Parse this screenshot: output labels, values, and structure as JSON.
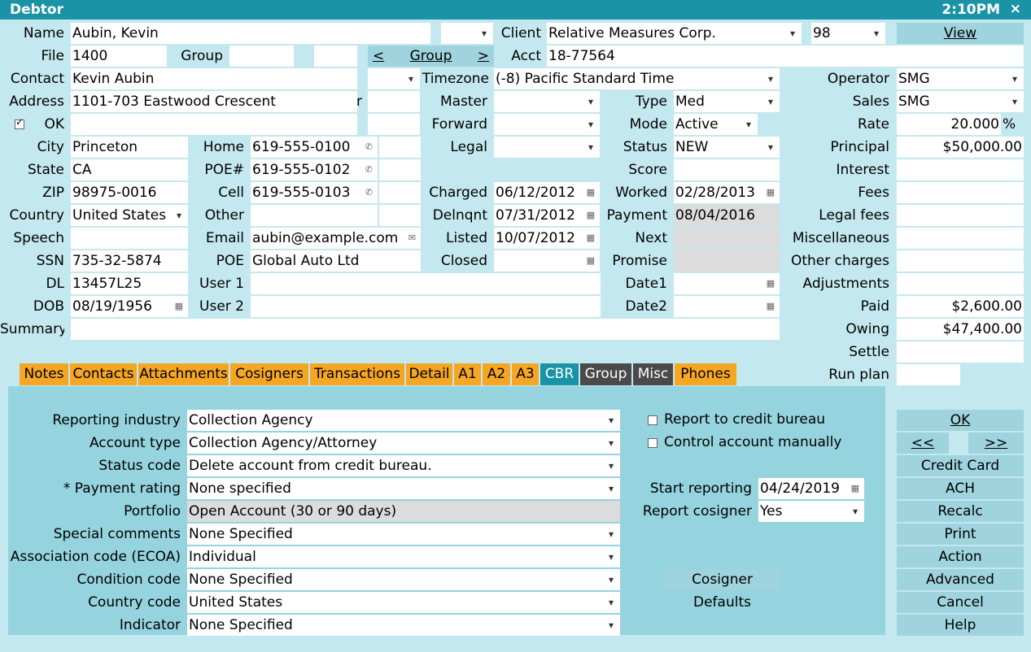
{
  "titlebar": {
    "title": "Debtor",
    "time": "2:10PM",
    "close": "×"
  },
  "labels": {
    "name": "Name",
    "client": "Client",
    "file": "File",
    "group": "Group",
    "acct": "Acct",
    "contact": "Contact",
    "timezone": "Timezone",
    "operator": "Operator",
    "address": "Address",
    "address_r": "r",
    "master": "Master",
    "type": "Type",
    "sales": "Sales",
    "ok": "OK",
    "forward": "Forward",
    "mode": "Mode",
    "rate": "Rate",
    "city": "City",
    "home": "Home",
    "legal": "Legal",
    "status": "Status",
    "principal": "Principal",
    "state": "State",
    "poe_num": "POE#",
    "score": "Score",
    "interest": "Interest",
    "zip": "ZIP",
    "cell": "Cell",
    "charged": "Charged",
    "worked": "Worked",
    "fees": "Fees",
    "country": "Country",
    "other": "Other",
    "delnqnt": "Delnqnt",
    "payment": "Payment",
    "legal_fees": "Legal fees",
    "speech": "Speech",
    "email": "Email",
    "listed": "Listed",
    "next": "Next",
    "misc": "Miscellaneous",
    "ssn": "SSN",
    "poe": "POE",
    "closed": "Closed",
    "promise": "Promise",
    "other_charges": "Other charges",
    "dl": "DL",
    "user1": "User 1",
    "date1": "Date1",
    "adjustments": "Adjustments",
    "dob": "DOB",
    "user2": "User 2",
    "date2": "Date2",
    "paid": "Paid",
    "summary": "Summary",
    "owing": "Owing",
    "settle": "Settle",
    "run_plan": "Run plan"
  },
  "values": {
    "name": "Aubin, Kevin",
    "client": "Relative Measures Corp.",
    "client_num": "98",
    "file": "1400",
    "acct": "18-77564",
    "contact": "Kevin Aubin",
    "timezone": "(-8) Pacific Standard Time",
    "operator": "SMG",
    "address": "1101-703 Eastwood Crescent",
    "type": "Med",
    "sales": "SMG",
    "mode": "Active",
    "rate": "20.000",
    "rate_unit": "%",
    "city": "Princeton",
    "home": "619-555-0100",
    "status": "NEW",
    "principal": "$50,000.00",
    "state": "CA",
    "poe_phone": "619-555-0102",
    "zip": "98975-0016",
    "cell": "619-555-0103",
    "charged": "06/12/2012",
    "worked": "02/28/2013",
    "country": "United States",
    "delnqnt": "07/31/2012",
    "payment": "08/04/2016",
    "email": "aubin@example.com",
    "listed": "10/07/2012",
    "ssn": "735-32-5874",
    "poe": "Global Auto Ltd",
    "dl": "13457L25",
    "dob": "08/19/1956",
    "paid": "$2,600.00",
    "owing": "$47,400.00"
  },
  "buttons": {
    "view": "View",
    "group_prev": "<",
    "group": "Group",
    "group_next": ">"
  },
  "tabs": [
    "Notes",
    "Contacts",
    "Attachments",
    "Cosigners",
    "Transactions",
    "Detail",
    "A1",
    "A2",
    "A3",
    "CBR",
    "Group",
    "Misc",
    "Phones"
  ],
  "cbr": {
    "reporting_industry_label": "Reporting industry",
    "reporting_industry": "Collection Agency",
    "account_type_label": "Account type",
    "account_type": "Collection Agency/Attorney",
    "status_code_label": "Status code",
    "status_code": "Delete account from credit bureau.",
    "payment_rating_label": "* Payment rating",
    "payment_rating": "None specified",
    "portfolio_label": "Portfolio",
    "portfolio": "Open Account (30 or 90 days)",
    "special_comments_label": "Special comments",
    "special_comments": "None Specified",
    "ecoa_label": "Association code (ECOA)",
    "ecoa": "Individual",
    "condition_code_label": "Condition code",
    "condition_code": "None Specified",
    "country_code_label": "Country code",
    "country_code": "United States",
    "indicator_label": "Indicator",
    "indicator": "None Specified",
    "report_to_bureau": "Report to credit bureau",
    "control_manually": "Control account manually",
    "start_reporting_label": "Start reporting",
    "start_reporting": "04/24/2019",
    "report_cosigner_label": "Report cosigner",
    "report_cosigner": "Yes",
    "cosigner_btn": "Cosigner",
    "defaults_btn": "Defaults"
  },
  "side_buttons": {
    "ok": "OK",
    "prev": "<<",
    "next": ">>",
    "credit_card": "Credit Card",
    "ach": "ACH",
    "recalc": "Recalc",
    "print": "Print",
    "action": "Action",
    "advanced": "Advanced",
    "cancel": "Cancel",
    "help": "Help"
  },
  "colors": {
    "titlebar": "#1a93a6",
    "background": "#c4e8ef",
    "tab_orange": "#f5a623",
    "tab_active": "#1a93a6",
    "tab_dark": "#4a4a4a",
    "panel": "#95d3de"
  }
}
